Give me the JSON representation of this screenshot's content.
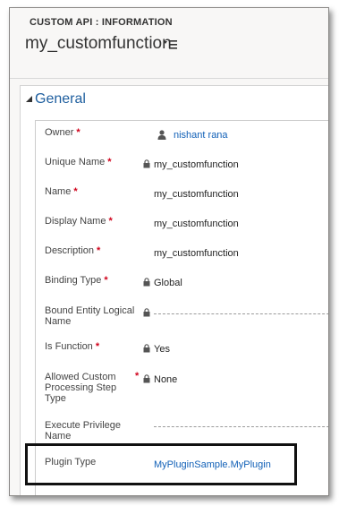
{
  "header": {
    "entity_type": "CUSTOM API : INFORMATION",
    "record_name": "my_customfunction"
  },
  "section": {
    "title": "General"
  },
  "fields": {
    "owner": {
      "label": "Owner",
      "required": "*",
      "value": "nishant rana"
    },
    "unique_name": {
      "label": "Unique Name",
      "required": "*",
      "value": "my_customfunction"
    },
    "name": {
      "label": "Name",
      "required": "*",
      "value": "my_customfunction"
    },
    "display_name": {
      "label": "Display Name",
      "required": "*",
      "value": "my_customfunction"
    },
    "description": {
      "label": "Description",
      "required": "*",
      "value": "my_customfunction"
    },
    "binding_type": {
      "label": "Binding Type",
      "required": "*",
      "value": "Global"
    },
    "bound_entity": {
      "label": "Bound Entity Logical Name",
      "value": ""
    },
    "is_function": {
      "label": "Is Function",
      "required": "*",
      "value": "Yes"
    },
    "allowed_custom_processing": {
      "label": "Allowed Custom Processing Step Type",
      "required": "*",
      "value": "None"
    },
    "execute_privilege": {
      "label": "Execute Privilege Name",
      "value": ""
    },
    "plugin_type": {
      "label": "Plugin Type",
      "value": "MyPluginSample.MyPlugin"
    }
  },
  "colors": {
    "link": "#1160b7",
    "section_title": "#1f5f9f",
    "required": "#d0021b"
  },
  "icons": [
    "chevron-menu-icon",
    "collapse-triangle-icon",
    "user-icon",
    "lock-icon"
  ]
}
